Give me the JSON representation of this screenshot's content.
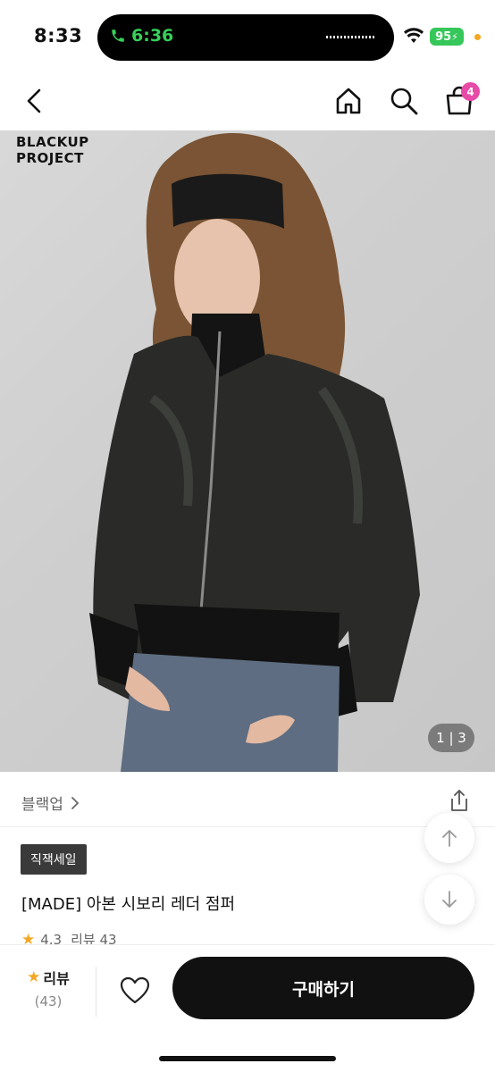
{
  "status_bar": {
    "time": "8:33",
    "call_time": "6:36",
    "battery": "95",
    "call_color": "#36d05a",
    "battery_color": "#35c759"
  },
  "nav": {
    "back_icon": "chevron-left-icon",
    "home_icon": "home-icon",
    "search_icon": "search-icon",
    "cart_icon": "shopping-bag-icon",
    "cart_count": "4",
    "badge_color": "#e84aa8"
  },
  "hero": {
    "brand_logo_line1": "BLACKUP",
    "brand_logo_line2": "PROJECT",
    "page_indicator": "1 | 3"
  },
  "product": {
    "brand_name": "블랙업",
    "tag": "직잭세일",
    "title": "[MADE] 아본 시보리 레더 점퍼",
    "rating": "4.3",
    "review_label": "리뷰 43"
  },
  "bottom_bar": {
    "review_label": "리뷰",
    "review_count": "(43)",
    "buy_label": "구매하기"
  }
}
